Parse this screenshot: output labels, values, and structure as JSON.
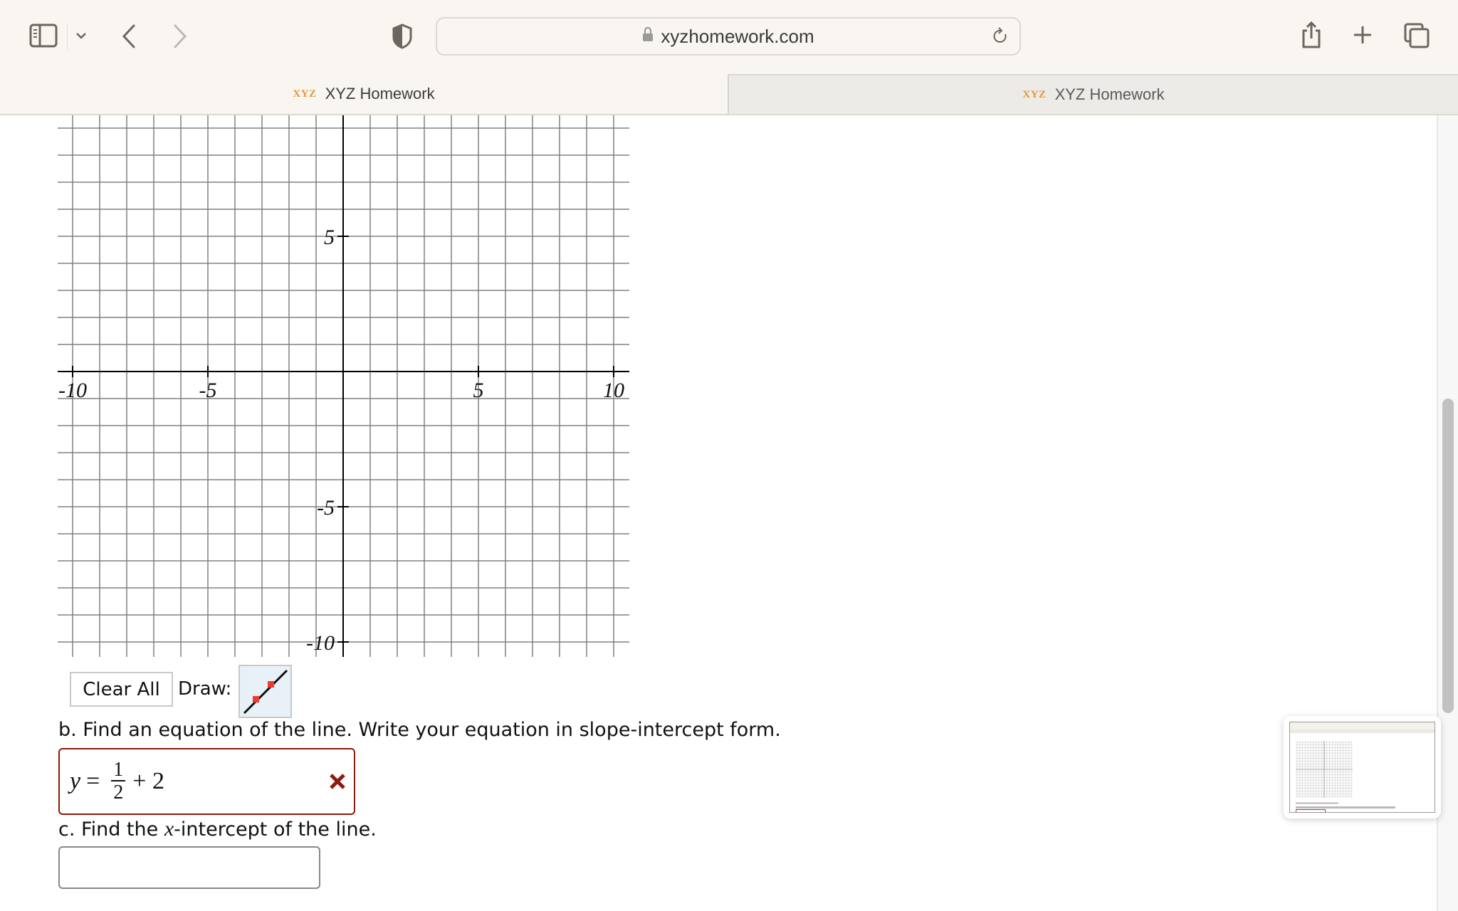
{
  "browser": {
    "url": "xyzhomework.com",
    "toolbar_icons": [
      "sidebar-icon",
      "chevron-down-icon",
      "back-icon",
      "forward-icon",
      "shield-icon",
      "lock-icon",
      "reload-icon",
      "share-icon",
      "new-tab-icon",
      "tab-overview-icon"
    ],
    "tabs": [
      {
        "favicon": "XYZ",
        "title": "XYZ Homework",
        "active": true
      },
      {
        "favicon": "XYZ",
        "title": "XYZ Homework",
        "active": false
      }
    ]
  },
  "graph": {
    "x_range": [
      -10,
      10
    ],
    "y_range": [
      -10,
      10
    ],
    "grid_step": 1,
    "x_tick_labels": [
      "-10",
      "-5",
      "5",
      "10"
    ],
    "y_tick_labels": [
      "5",
      "-5",
      "-10"
    ],
    "gridline_color": "#808080",
    "axis_color": "#000000"
  },
  "controls": {
    "clear_all_label": "Clear All",
    "draw_label": "Draw:",
    "line_tool_icon": "line-tool-icon",
    "point_color": "#f03a2e"
  },
  "question_b": {
    "prompt": "b. Find an equation of the line. Write your equation in slope-intercept form.",
    "answer": {
      "lhs": "y",
      "equals": "=",
      "numerator": "1",
      "denominator": "2",
      "rest": "+ 2"
    },
    "status": "incorrect",
    "status_icon": "wrong-x-icon",
    "status_color": "#8b1a10"
  },
  "question_c": {
    "prompt_pre": "c. Find the ",
    "prompt_var": "x",
    "prompt_post": "-intercept of the line.",
    "answer_value": ""
  },
  "overlay": {
    "screenshot_thumbnail": "screenshot-thumbnail"
  }
}
